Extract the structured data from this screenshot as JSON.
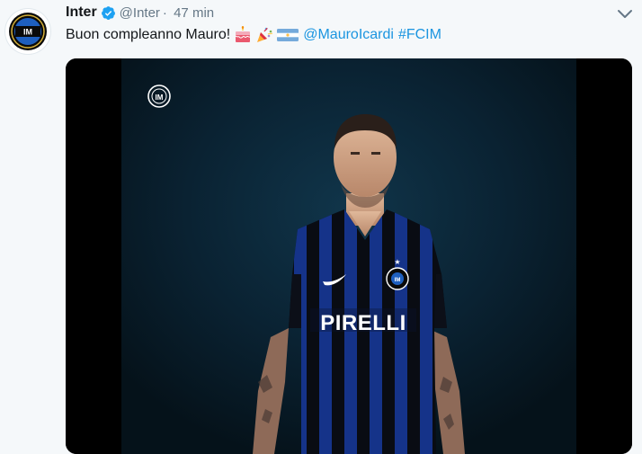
{
  "account": {
    "name": "Inter",
    "handle": "@Inter",
    "separator": "·",
    "time": "47 min",
    "avatar_icon": "inter-crest-icon",
    "verified_icon": "verified-badge-icon"
  },
  "tweet": {
    "text": "Buon compleanno Mauro!",
    "emojis": [
      "birthday-cake-icon",
      "party-popper-icon",
      "argentina-flag-icon"
    ],
    "mention": "@MauroIcardi",
    "hashtag": "#FCIM"
  },
  "media": {
    "watermark_icon": "inter-crest-icon",
    "shirt_sponsor": "PIRELLI"
  },
  "colors": {
    "link": "#1b95e0",
    "verified": "#1da1f2",
    "inter_blue": "#0b1f99",
    "background": "#f5f8fa"
  }
}
